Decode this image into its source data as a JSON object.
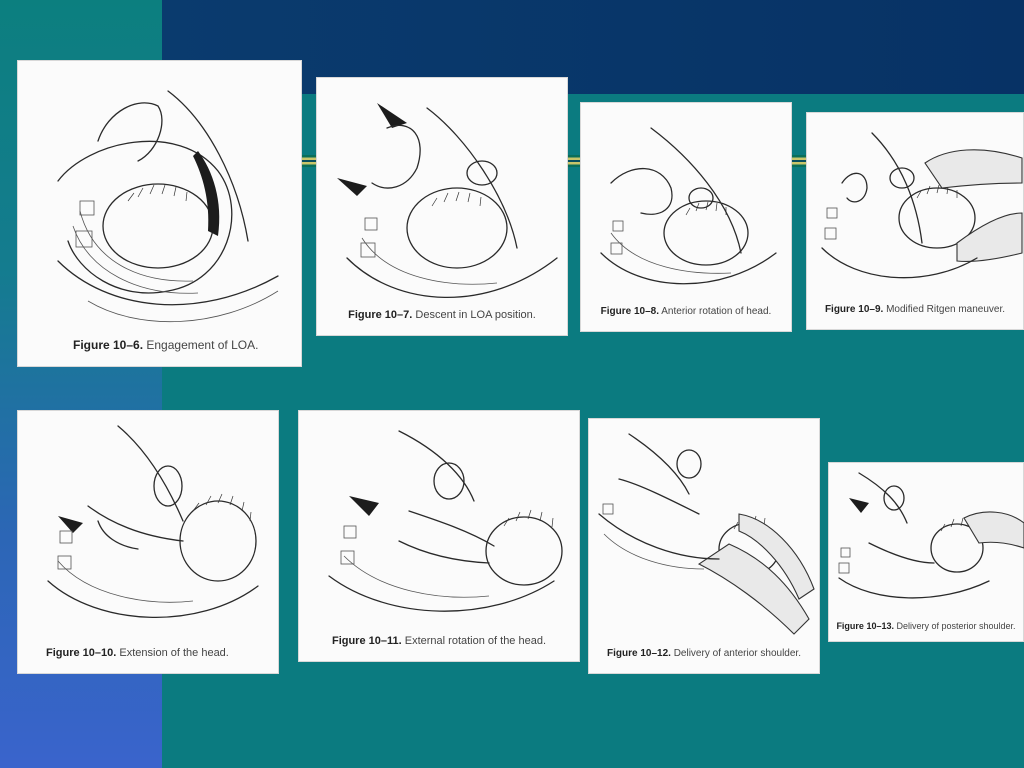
{
  "figures": [
    {
      "number": "Figure 10–6.",
      "text": "Engagement of LOA."
    },
    {
      "number": "Figure 10–7.",
      "text": "Descent in LOA position."
    },
    {
      "number": "Figure 10–8.",
      "text": "Anterior rotation of head."
    },
    {
      "number": "Figure 10–9.",
      "text": "Modified Ritgen maneuver."
    },
    {
      "number": "Figure 10–10.",
      "text": "Extension of the head."
    },
    {
      "number": "Figure 10–11.",
      "text": "External rotation of the head."
    },
    {
      "number": "Figure 10–12.",
      "text": "Delivery of anterior shoulder."
    },
    {
      "number": "Figure 10–13.",
      "text": "Delivery of posterior shoulder."
    }
  ],
  "colors": {
    "background": "#0b7b80",
    "top_band": "#0a3b6e",
    "left_band_bottom": "#3a64cc",
    "rule_accent": "#c9c56a",
    "figure_paper": "#fbfbfb"
  }
}
